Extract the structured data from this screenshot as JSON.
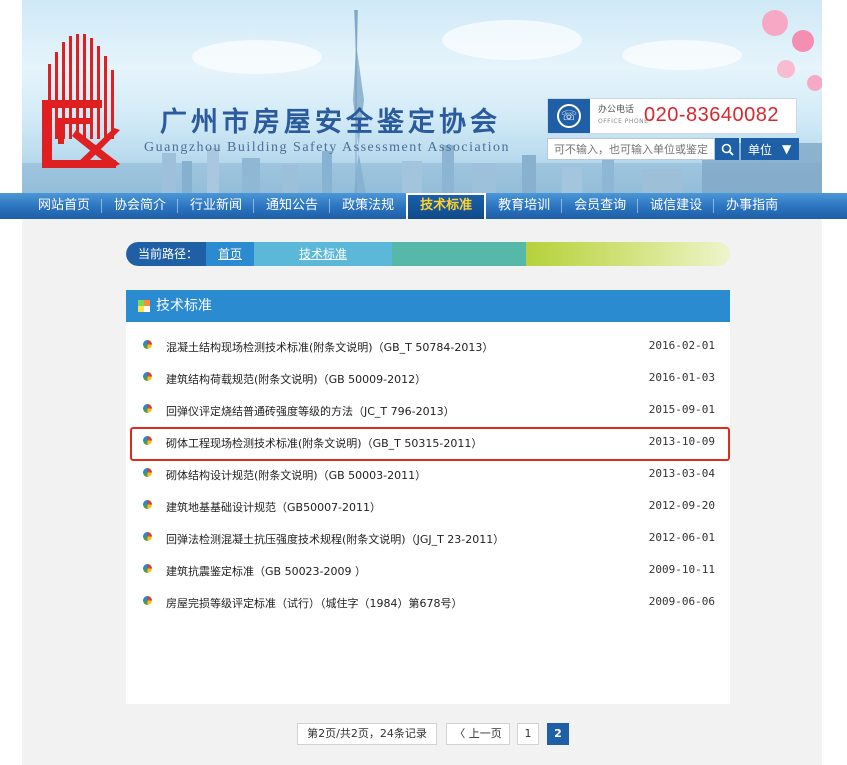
{
  "header": {
    "title": "广州市房屋安全鉴定协会",
    "subtitle": "Guangzhou Building Safety Assessment Association",
    "phone_label": "办公电话",
    "phone_label_en": "OFFICE PHONE",
    "phone_number": "020-83640082",
    "search_placeholder": "可不输入，也可输入单位或鉴定",
    "unit_select": "单位"
  },
  "nav": {
    "items": [
      {
        "label": "网站首页"
      },
      {
        "label": "协会简介"
      },
      {
        "label": "行业新闻"
      },
      {
        "label": "通知公告"
      },
      {
        "label": "政策法规"
      },
      {
        "label": "技术标准",
        "active": true
      },
      {
        "label": "教育培训"
      },
      {
        "label": "会员查询"
      },
      {
        "label": "诚信建设"
      },
      {
        "label": "办事指南"
      }
    ]
  },
  "breadcrumb": {
    "label": "当前路径：",
    "home": "首页",
    "current": "技术标准"
  },
  "panel": {
    "title": "技术标准"
  },
  "standards": [
    {
      "title": "混凝土结构现场检测技术标准(附条文说明)（GB_T 50784-2013）",
      "date": "2016-02-01"
    },
    {
      "title": "建筑结构荷载规范(附条文说明)（GB 50009-2012）",
      "date": "2016-01-03"
    },
    {
      "title": "回弹仪评定烧结普通砖强度等级的方法（JC_T 796-2013）",
      "date": "2015-09-01"
    },
    {
      "title": "砌体工程现场检测技术标准(附条文说明)（GB_T 50315-2011）",
      "date": "2013-10-09",
      "highlighted": true
    },
    {
      "title": "砌体结构设计规范(附条文说明)（GB 50003-2011）",
      "date": "2013-03-04"
    },
    {
      "title": "建筑地基基础设计规范（GB50007-2011）",
      "date": "2012-09-20"
    },
    {
      "title": "回弹法检测混凝土抗压强度技术规程(附条文说明)（JGJ_T 23-2011）",
      "date": "2012-06-01"
    },
    {
      "title": "建筑抗震鉴定标准（GB 50023-2009 ）",
      "date": "2009-10-11"
    },
    {
      "title": "房屋完损等级评定标准（试行）（城住字（1984）第678号）",
      "date": "2009-06-06"
    }
  ],
  "pagination": {
    "summary": "第2页/共2页，24条记录",
    "prev": "〈 上一页",
    "pages": [
      "1",
      "2"
    ],
    "current": "2"
  },
  "colors": {
    "nav_blue": "#2a73bf",
    "panel_blue": "#2a8bd0",
    "active_nav_text": "#ffd22e",
    "phone_red": "#d9272e",
    "highlight_red": "#e0291f"
  }
}
